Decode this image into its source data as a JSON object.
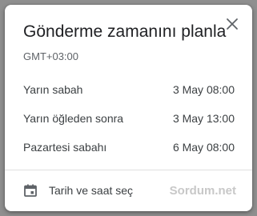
{
  "dialog": {
    "title": "Gönderme zamanını planla",
    "timezone": "GMT+03:00",
    "close_icon": "close-icon",
    "options": [
      {
        "label": "Yarın sabah",
        "time": "3 May 08:00"
      },
      {
        "label": "Yarın öğleden sonra",
        "time": "3 May 13:00"
      },
      {
        "label": "Pazartesi sabahı",
        "time": "6 May 08:00"
      }
    ],
    "custom_picker": {
      "icon": "calendar-icon",
      "label": "Tarih ve saat seç"
    },
    "watermark": "Sordum.net"
  },
  "colors": {
    "backdrop": "#8f8f8f",
    "surface": "#ffffff",
    "text_primary": "#202124",
    "text_secondary": "#5f6368",
    "watermark": "#c8c8c8"
  }
}
